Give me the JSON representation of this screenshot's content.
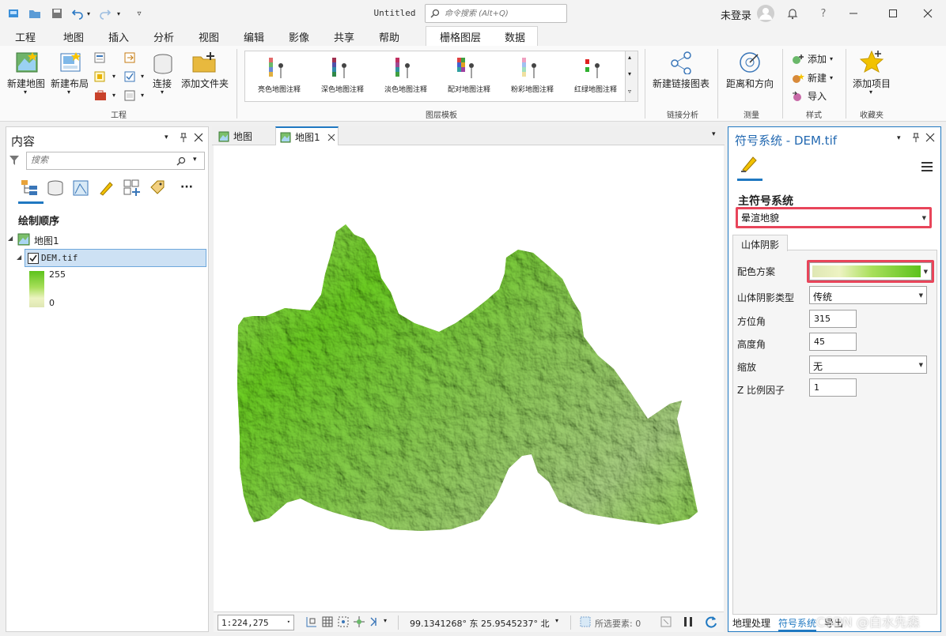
{
  "window": {
    "title": "Untitled",
    "command_search_placeholder": "命令搜索 (Alt+Q)",
    "login_status": "未登录"
  },
  "menu_tabs": [
    "工程",
    "地图",
    "插入",
    "分析",
    "视图",
    "编辑",
    "影像",
    "共享",
    "帮助"
  ],
  "active_menu_tab": "插入",
  "context_tabs": [
    "栅格图层",
    "数据"
  ],
  "ribbon": {
    "project_group": {
      "label": "工程",
      "new_map": "新建地图",
      "new_layout": "新建布局",
      "connect": "连接",
      "add_folder": "添加文件夹"
    },
    "layer_templates_group": {
      "label": "图层模板",
      "items": [
        "亮色地图注释",
        "深色地图注释",
        "淡色地图注释",
        "配对地图注释",
        "粉彩地图注释",
        "红绿地图注释"
      ]
    },
    "link_analysis_group": {
      "label": "链接分析",
      "new_link_chart": "新建链接图表"
    },
    "measure_group": {
      "label": "测量",
      "distance_direction": "距离和方向"
    },
    "style_group": {
      "label": "样式",
      "add": "添加",
      "new": "新建",
      "import": "导入"
    },
    "favorites_group": {
      "label": "收藏夹",
      "add_item": "添加项目"
    }
  },
  "contents_pane": {
    "title": "内容",
    "search_placeholder": "搜索",
    "drawing_order": "绘制顺序",
    "map_name": "地图1",
    "layer_name": "DEM.tif",
    "legend_max": "255",
    "legend_min": "0"
  },
  "map_tabs": [
    "地图",
    "地图1"
  ],
  "status_bar": {
    "scale": "1:224,275",
    "coordinates": "99.1341268° 东 25.9545237° 北",
    "selected_features": "所选要素: 0"
  },
  "symbology_pane": {
    "title": "符号系统 - DEM.tif",
    "primary_symbology_label": "主符号系统",
    "primary_symbology_value": "晕渲地貌",
    "tab_label": "山体阴影",
    "color_scheme_label": "配色方案",
    "hillshade_type_label": "山体阴影类型",
    "hillshade_type_value": "传统",
    "azimuth_label": "方位角",
    "azimuth_value": "315",
    "altitude_label": "高度角",
    "altitude_value": "45",
    "stretch_label": "缩放",
    "stretch_value": "无",
    "z_factor_label": "Z 比例因子",
    "z_factor_value": "1"
  },
  "bottom_tabs": [
    "地理处理",
    "符号系统",
    "导出"
  ],
  "watermark": "CSDN @白水先森",
  "colors": {
    "accent": "#1f78c1",
    "highlight_border": "#e8455a",
    "selection_fill": "#cde1f4",
    "terrain_green": "#5cc21c",
    "terrain_pale": "#e9edc4"
  }
}
